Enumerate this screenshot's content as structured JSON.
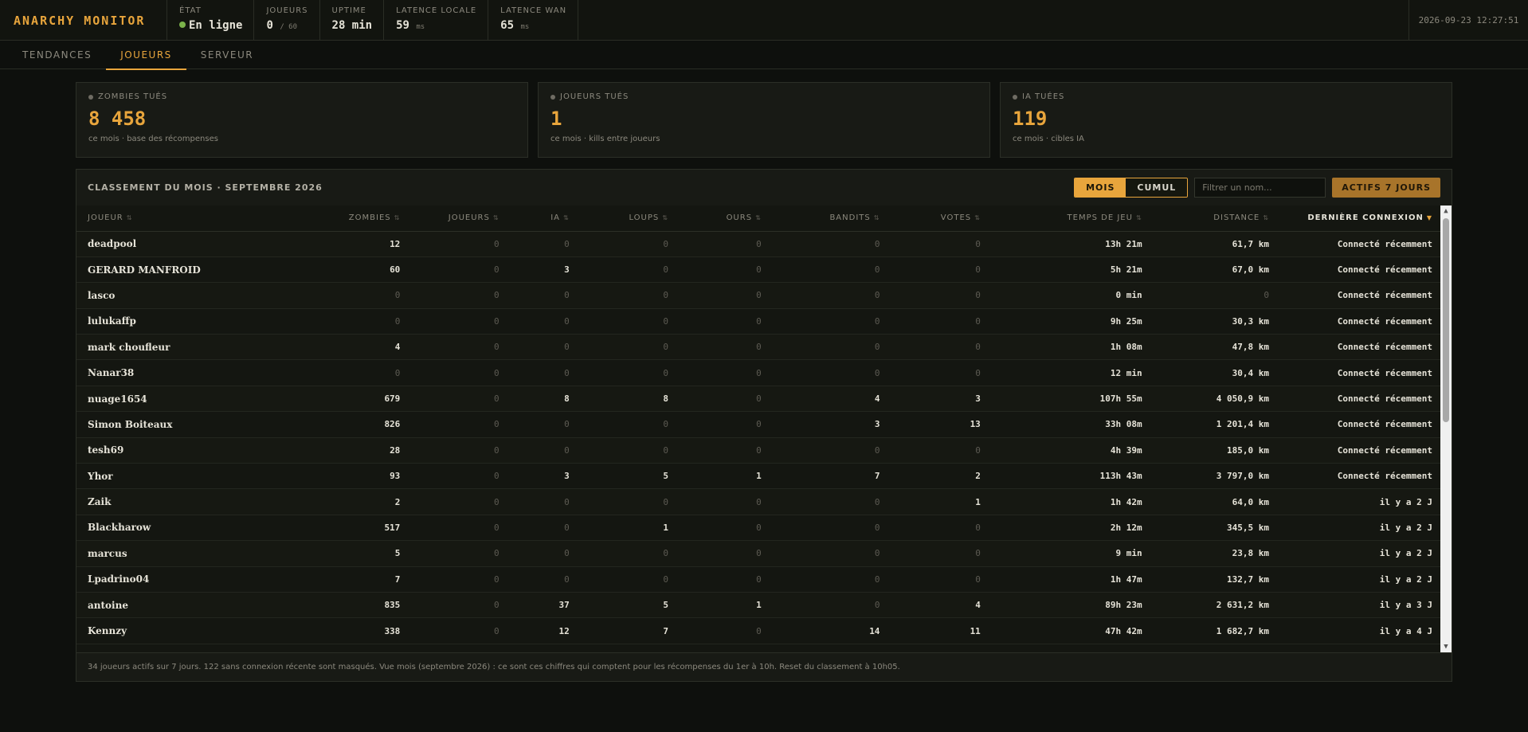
{
  "app": {
    "title": "ANARCHY MONITOR",
    "clock": "2026-09-23 12:27:51"
  },
  "status": [
    {
      "label": "ÉTAT",
      "value": "En ligne",
      "suffix": "",
      "dot": true
    },
    {
      "label": "JOUEURS",
      "value": "0",
      "suffix": "/ 60",
      "dot": false
    },
    {
      "label": "UPTIME",
      "value": "28 min",
      "suffix": "",
      "dot": false
    },
    {
      "label": "LATENCE LOCALE",
      "value": "59",
      "suffix": "ms",
      "dot": false
    },
    {
      "label": "LATENCE WAN",
      "value": "65",
      "suffix": "ms",
      "dot": false
    }
  ],
  "tabs": [
    {
      "label": "TENDANCES",
      "active": false
    },
    {
      "label": "JOUEURS",
      "active": true
    },
    {
      "label": "SERVEUR",
      "active": false
    }
  ],
  "kpis": [
    {
      "label": "ZOMBIES TUÉS",
      "value": "8 458",
      "desc": "ce mois · base des récompenses"
    },
    {
      "label": "JOUEURS TUÉS",
      "value": "1",
      "desc": "ce mois · kills entre joueurs"
    },
    {
      "label": "IA TUÉES",
      "value": "119",
      "desc": "ce mois · cibles IA"
    }
  ],
  "ranking": {
    "title": "CLASSEMENT DU MOIS · SEPTEMBRE 2026",
    "toggle": {
      "month": "MOIS",
      "total": "CUMUL"
    },
    "filter_placeholder": "Filtrer un nom...",
    "active_button": "ACTIFS 7 JOURS",
    "columns": [
      "JOUEUR",
      "ZOMBIES",
      "JOUEURS",
      "IA",
      "LOUPS",
      "OURS",
      "BANDITS",
      "VOTES",
      "TEMPS DE JEU",
      "DISTANCE",
      "DERNIÈRE CONNEXION"
    ],
    "rows": [
      [
        "deadpool",
        "12",
        "0",
        "0",
        "0",
        "0",
        "0",
        "0",
        "13h 21m",
        "61,7 km",
        "Connecté récemment"
      ],
      [
        "GERARD MANFROID",
        "60",
        "0",
        "3",
        "0",
        "0",
        "0",
        "0",
        "5h 21m",
        "67,0 km",
        "Connecté récemment"
      ],
      [
        "lasco",
        "0",
        "0",
        "0",
        "0",
        "0",
        "0",
        "0",
        "0 min",
        "0",
        "Connecté récemment"
      ],
      [
        "lulukaffp",
        "0",
        "0",
        "0",
        "0",
        "0",
        "0",
        "0",
        "9h 25m",
        "30,3 km",
        "Connecté récemment"
      ],
      [
        "mark choufleur",
        "4",
        "0",
        "0",
        "0",
        "0",
        "0",
        "0",
        "1h 08m",
        "47,8 km",
        "Connecté récemment"
      ],
      [
        "Nanar38",
        "0",
        "0",
        "0",
        "0",
        "0",
        "0",
        "0",
        "12 min",
        "30,4 km",
        "Connecté récemment"
      ],
      [
        "nuage1654",
        "679",
        "0",
        "8",
        "8",
        "0",
        "4",
        "3",
        "107h 55m",
        "4 050,9 km",
        "Connecté récemment"
      ],
      [
        "Simon Boiteaux",
        "826",
        "0",
        "0",
        "0",
        "0",
        "3",
        "13",
        "33h 08m",
        "1 201,4 km",
        "Connecté récemment"
      ],
      [
        "tesh69",
        "28",
        "0",
        "0",
        "0",
        "0",
        "0",
        "0",
        "4h 39m",
        "185,0 km",
        "Connecté récemment"
      ],
      [
        "Yhor",
        "93",
        "0",
        "3",
        "5",
        "1",
        "7",
        "2",
        "113h 43m",
        "3 797,0 km",
        "Connecté récemment"
      ],
      [
        "Zaik",
        "2",
        "0",
        "0",
        "0",
        "0",
        "0",
        "1",
        "1h 42m",
        "64,0 km",
        "il y a 2 J"
      ],
      [
        "Blackharow",
        "517",
        "0",
        "0",
        "1",
        "0",
        "0",
        "0",
        "2h 12m",
        "345,5 km",
        "il y a 2 J"
      ],
      [
        "marcus",
        "5",
        "0",
        "0",
        "0",
        "0",
        "0",
        "0",
        "9 min",
        "23,8 km",
        "il y a 2 J"
      ],
      [
        "Lpadrino04",
        "7",
        "0",
        "0",
        "0",
        "0",
        "0",
        "0",
        "1h 47m",
        "132,7 km",
        "il y a 2 J"
      ],
      [
        "antoine",
        "835",
        "0",
        "37",
        "5",
        "1",
        "0",
        "4",
        "89h 23m",
        "2 631,2 km",
        "il y a 3 J"
      ],
      [
        "Kennzy",
        "338",
        "0",
        "12",
        "7",
        "0",
        "14",
        "11",
        "47h 42m",
        "1 682,7 km",
        "il y a 4 J"
      ]
    ],
    "footer": "34 joueurs actifs sur 7 jours. 122 sans connexion récente sont masqués. Vue mois (septembre 2026) : ce sont ces chiffres qui comptent pour les récompenses du 1er à 10h. Reset du classement à 10h05."
  },
  "colors": {
    "accent": "#e8a53c",
    "online": "#7bb24a",
    "background": "#0e100d"
  }
}
